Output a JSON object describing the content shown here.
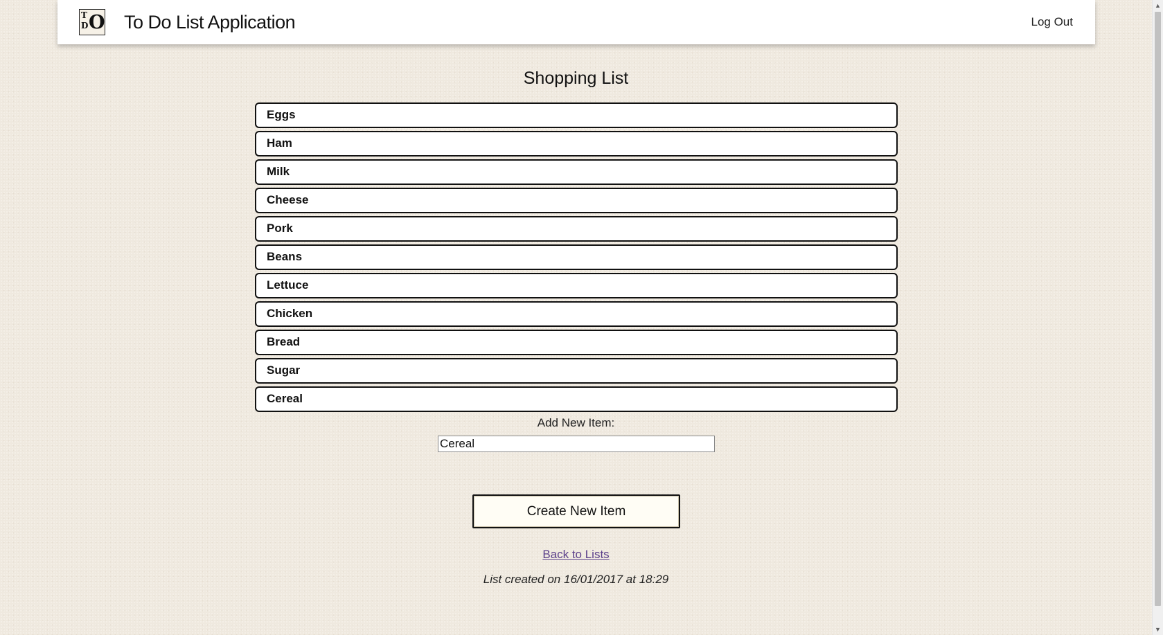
{
  "header": {
    "logo": {
      "t": "T",
      "d": "D",
      "o": "O"
    },
    "app_title": "To Do List Application",
    "logout_label": "Log Out"
  },
  "list": {
    "title": "Shopping List",
    "items": [
      {
        "label": "Eggs"
      },
      {
        "label": "Ham"
      },
      {
        "label": "Milk"
      },
      {
        "label": "Cheese"
      },
      {
        "label": "Pork"
      },
      {
        "label": "Beans"
      },
      {
        "label": "Lettuce"
      },
      {
        "label": "Chicken"
      },
      {
        "label": "Bread"
      },
      {
        "label": "Sugar"
      },
      {
        "label": "Cereal"
      }
    ]
  },
  "form": {
    "add_label": "Add New Item:",
    "input_value": "Cereal",
    "create_button_label": "Create New Item"
  },
  "footer": {
    "back_link_label": "Back to Lists",
    "created_text": "List created on 16/01/2017 at 18:29"
  },
  "scrollbar": {
    "up_icon": "▲",
    "down_icon": "▼"
  }
}
